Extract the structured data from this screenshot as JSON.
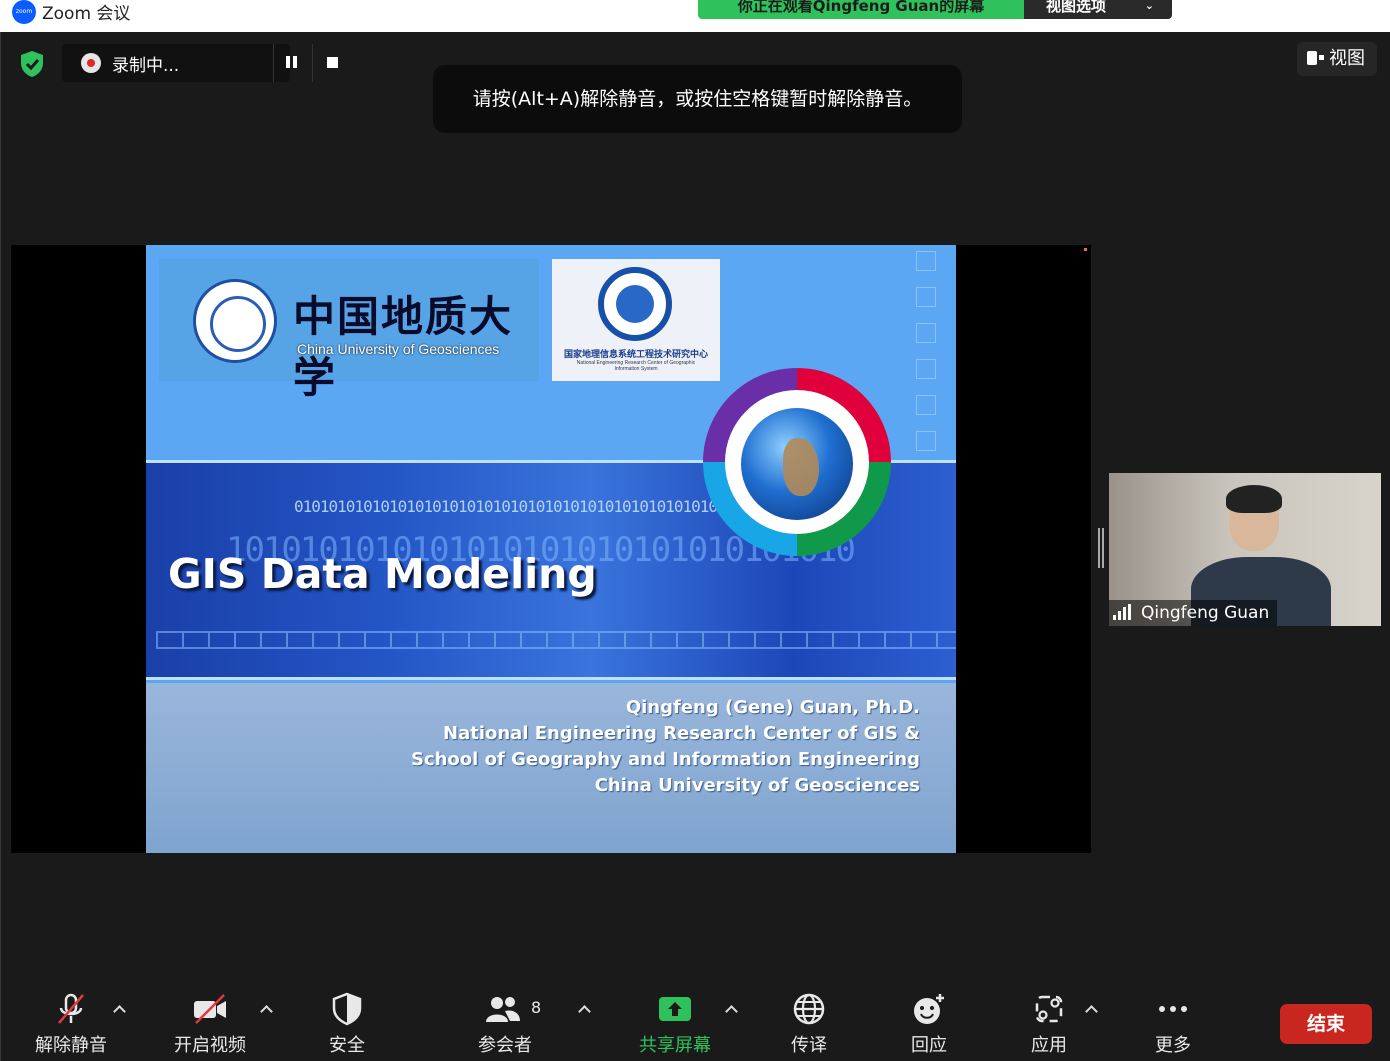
{
  "window": {
    "app_title": "Zoom 会议",
    "logo_text": "zoom"
  },
  "banner": {
    "viewing_text": "你正在观看Qingfeng Guan的屏幕",
    "view_options_label": "视图选项"
  },
  "recording": {
    "label": "录制中..."
  },
  "notification": {
    "text": "请按(Alt+A)解除静音，或按住空格键暂时解除静音。"
  },
  "view_button": {
    "label": "视图"
  },
  "slide": {
    "logo_cn": "中国地质大学",
    "logo_en": "China University of Geosciences",
    "nerc_cn": "国家地理信息系统工程技术研究中心",
    "nerc_en": "National Engineering Research Center of Geographic Information System",
    "binary_small": "0101010101010101010101010101010101010101010101010101010101010101",
    "binary_large": "1010101010101010101010101010101010",
    "title": "GIS Data Modeling",
    "credits": [
      "Qingfeng (Gene) Guan, Ph.D.",
      "National Engineering Research Center of GIS &",
      "School of Geography and Information Engineering",
      "China University of Geosciences"
    ]
  },
  "participant_video": {
    "name": "Qingfeng Guan"
  },
  "toolbar": {
    "unmute": "解除静音",
    "start_video": "开启视频",
    "security": "安全",
    "participants": "参会者",
    "participants_count": "8",
    "share_screen": "共享屏幕",
    "interpret": "传译",
    "reactions": "回应",
    "apps": "应用",
    "more": "更多",
    "end": "结束",
    "share_color": "#2fc15b"
  }
}
